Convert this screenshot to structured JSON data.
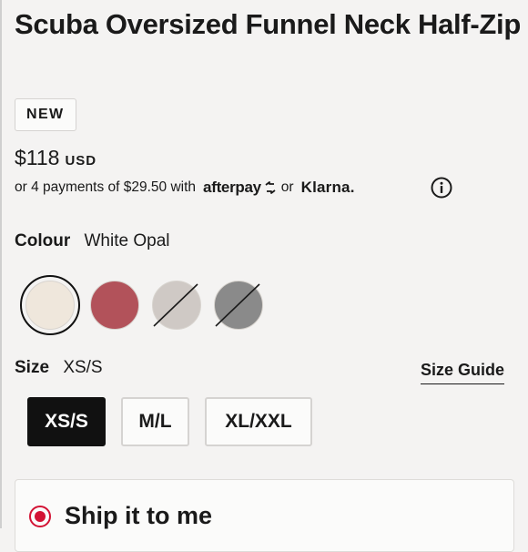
{
  "product": {
    "title": "Scuba Oversized Funnel Neck Half-Zip",
    "badge": "NEW",
    "price": "$118",
    "currency": "USD"
  },
  "payment": {
    "installments_text": "or 4 payments of $29.50 with",
    "afterpay_logo": "afterpay",
    "or_text": "or",
    "klarna_logo": "Klarna.",
    "info_icon": "info-circle-icon"
  },
  "colour": {
    "label": "Colour",
    "selected": "White Opal",
    "swatches": [
      {
        "name": "White Opal",
        "color": "#efe7dc",
        "selected": true,
        "available": true
      },
      {
        "name": "Mulled Wine",
        "color": "#b2525a",
        "selected": false,
        "available": true
      },
      {
        "name": "Light Grey",
        "color": "#cfc9c5",
        "selected": false,
        "available": false
      },
      {
        "name": "Grey",
        "color": "#8a8a8a",
        "selected": false,
        "available": false
      }
    ]
  },
  "size": {
    "label": "Size",
    "selected": "XS/S",
    "guide_link": "Size Guide",
    "options": [
      "XS/S",
      "M/L",
      "XL/XXL"
    ]
  },
  "fulfillment": {
    "ship_label": "Ship it to me",
    "accent": "#d31334"
  }
}
